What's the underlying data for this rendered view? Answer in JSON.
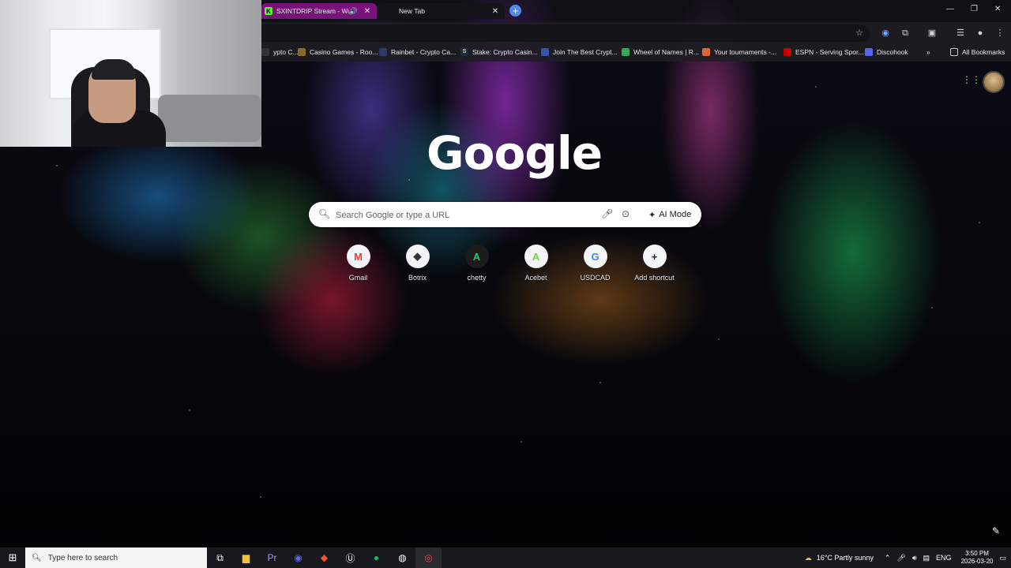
{
  "browser": {
    "tabs": [
      {
        "title": "SXINTDRIP Stream - Watch",
        "favicon": "K"
      },
      {
        "title": "New Tab"
      }
    ]
  },
  "bookmarks": [
    {
      "label": "ypto C...",
      "color": "#333"
    },
    {
      "label": "Casino Games - Roo...",
      "color": "#8a6a2a"
    },
    {
      "label": "Rainbet - Crypto Ca...",
      "color": "#2a3a6a"
    },
    {
      "label": "Stake: Crypto Casin...",
      "color": "#1a2c38"
    },
    {
      "label": "Join The Best Crypt...",
      "color": "#3355aa"
    },
    {
      "label": "Wheel of Names | R...",
      "color": "#33aa55"
    },
    {
      "label": "Your tournaments -...",
      "color": "#dd6633"
    },
    {
      "label": "ESPN - Serving Spor...",
      "color": "#cc0000"
    },
    {
      "label": "Discohook",
      "color": "#5865f2"
    }
  ],
  "all_bookmarks": "All Bookmarks",
  "google": {
    "logo": "Google",
    "search_placeholder": "Search Google or type a URL",
    "ai_mode": "AI Mode",
    "shortcuts": [
      {
        "label": "Gmail",
        "glyph": "M",
        "color": "#ea4335"
      },
      {
        "label": "Botrix",
        "glyph": "◆",
        "color": "#333"
      },
      {
        "label": "chetty",
        "glyph": "A",
        "color": "#2fbf71"
      },
      {
        "label": "Acebet",
        "glyph": "A",
        "color": "#6adf3a"
      },
      {
        "label": "USDCAD",
        "glyph": "G",
        "color": "#4285f4"
      },
      {
        "label": "Add shortcut",
        "glyph": "+",
        "color": "#202124"
      }
    ]
  },
  "taskbar": {
    "search_label": "Type here to search",
    "weather": "16°C  Partly sunny",
    "lang": "ENG",
    "time": "3:50 PM",
    "date": "2026-03-20"
  }
}
